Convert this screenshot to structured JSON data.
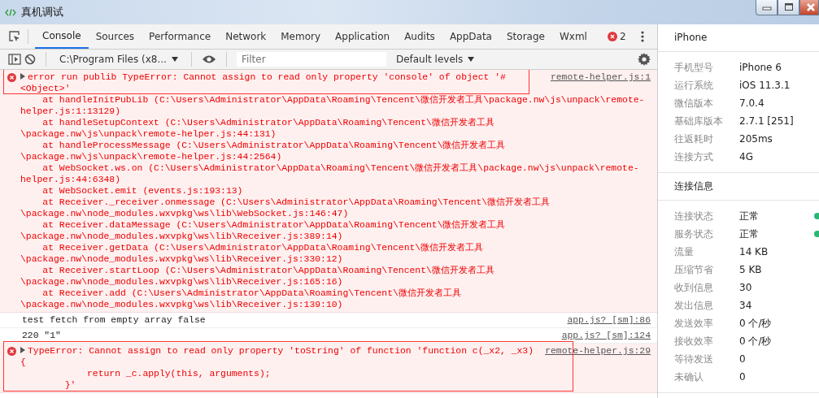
{
  "window": {
    "title": "真机调试"
  },
  "tabs": [
    {
      "label": "Console",
      "selected": true
    },
    {
      "label": "Sources",
      "selected": false
    },
    {
      "label": "Performance",
      "selected": false
    },
    {
      "label": "Network",
      "selected": false
    },
    {
      "label": "Memory",
      "selected": false
    },
    {
      "label": "Application",
      "selected": false
    },
    {
      "label": "Audits",
      "selected": false
    },
    {
      "label": "AppData",
      "selected": false
    },
    {
      "label": "Storage",
      "selected": false
    },
    {
      "label": "Wxml",
      "selected": false
    }
  ],
  "error_count": "2",
  "toolbar": {
    "context": "C:\\Program Files (x8...",
    "filter": {
      "placeholder": "Filter"
    },
    "levels": "Default levels"
  },
  "messages": [
    {
      "kind": "error",
      "source": "remote-helper.js:1",
      "lines": [
        "error run publib TypeError: Cannot assign to read only property 'console' of object '#",
        "<Object>'",
        "    at handleInitPubLib (C:\\Users\\Administrator\\AppData\\Roaming\\Tencent\\微信开发者工具\\package.nw\\js\\unpack\\remote-",
        "helper.js:1:13129)",
        "    at handleSetupContext (C:\\Users\\Administrator\\AppData\\Roaming\\Tencent\\微信开发者工具",
        "\\package.nw\\js\\unpack\\remote-helper.js:44:131)",
        "    at handleProcessMessage (C:\\Users\\Administrator\\AppData\\Roaming\\Tencent\\微信开发者工具",
        "\\package.nw\\js\\unpack\\remote-helper.js:44:2564)",
        "    at WebSocket.ws.on (C:\\Users\\Administrator\\AppData\\Roaming\\Tencent\\微信开发者工具\\package.nw\\js\\unpack\\remote-",
        "helper.js:44:6348)",
        "    at WebSocket.emit (events.js:193:13)",
        "    at Receiver._receiver.onmessage (C:\\Users\\Administrator\\AppData\\Roaming\\Tencent\\微信开发者工具",
        "\\package.nw\\node_modules.wxvpkg\\ws\\lib\\WebSocket.js:146:47)",
        "    at Receiver.dataMessage (C:\\Users\\Administrator\\AppData\\Roaming\\Tencent\\微信开发者工具",
        "\\package.nw\\node_modules.wxvpkg\\ws\\lib\\Receiver.js:389:14)",
        "    at Receiver.getData (C:\\Users\\Administrator\\AppData\\Roaming\\Tencent\\微信开发者工具",
        "\\package.nw\\node_modules.wxvpkg\\ws\\lib\\Receiver.js:330:12)",
        "    at Receiver.startLoop (C:\\Users\\Administrator\\AppData\\Roaming\\Tencent\\微信开发者工具",
        "\\package.nw\\node_modules.wxvpkg\\ws\\lib\\Receiver.js:165:16)",
        "    at Receiver.add (C:\\Users\\Administrator\\AppData\\Roaming\\Tencent\\微信开发者工具",
        "\\package.nw\\node_modules.wxvpkg\\ws\\lib\\Receiver.js:139:10)"
      ]
    },
    {
      "kind": "log",
      "source": "app.js? [sm]:86",
      "lines": [
        "test fetch from empty array false"
      ]
    },
    {
      "kind": "log",
      "source": "app.js? [sm]:124",
      "lines": [
        "220 \"1\""
      ]
    },
    {
      "kind": "error",
      "source": "remote-helper.js:29",
      "lines": [
        "TypeError: Cannot assign to read only property 'toString' of function 'function c(_x2, _x3)",
        "{",
        "            return _c.apply(this, arguments);",
        "        }'"
      ]
    }
  ],
  "device": {
    "title": "iPhone",
    "rows": [
      {
        "label": "手机型号",
        "value": "iPhone 6"
      },
      {
        "label": "运行系统",
        "value": "iOS 11.3.1"
      },
      {
        "label": "微信版本",
        "value": "7.0.4"
      },
      {
        "label": "基础库版本",
        "value": "2.7.1 [251]"
      },
      {
        "label": "往返耗时",
        "value": "205ms"
      },
      {
        "label": "连接方式",
        "value": "4G"
      }
    ]
  },
  "connection": {
    "title": "连接信息",
    "rows": [
      {
        "label": "连接状态",
        "value": "正常",
        "color": "#2bb673"
      },
      {
        "label": "服务状态",
        "value": "正常",
        "color": "#2bb673"
      },
      {
        "label": "流量",
        "value": "14 KB"
      },
      {
        "label": "压缩节省",
        "value": "5 KB"
      },
      {
        "label": "收到信息",
        "value": "30"
      },
      {
        "label": "发出信息",
        "value": "34"
      },
      {
        "label": "发送效率",
        "value": "0 个/秒"
      },
      {
        "label": "接收效率",
        "value": "0 个/秒"
      },
      {
        "label": "等待发送",
        "value": "0"
      },
      {
        "label": "未确认",
        "value": "0"
      }
    ]
  }
}
